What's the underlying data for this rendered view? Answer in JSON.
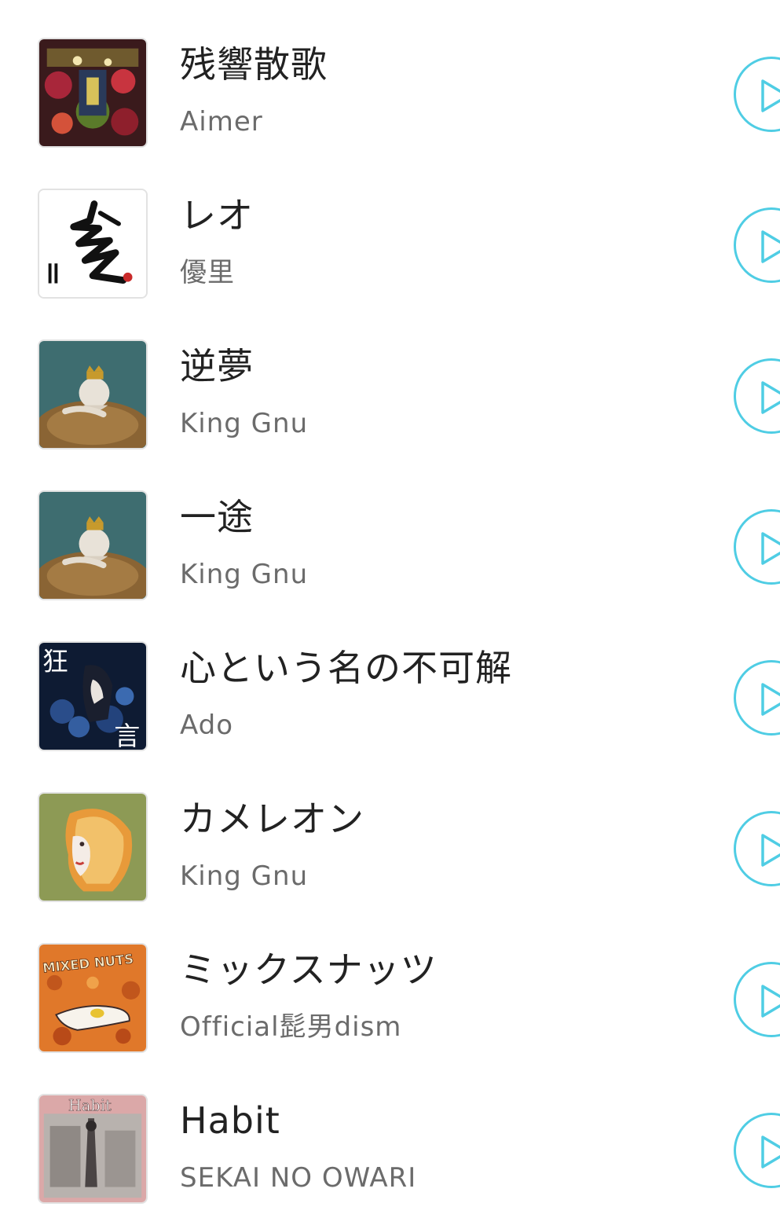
{
  "songs": [
    {
      "title": "残響散歌",
      "artist": "Aimer",
      "cover": "zankyosanka-cover"
    },
    {
      "title": "レオ",
      "artist": "優里",
      "cover": "leo-cover"
    },
    {
      "title": "逆夢",
      "artist": "King Gnu",
      "cover": "sakayume-cover"
    },
    {
      "title": "一途",
      "artist": "King Gnu",
      "cover": "ichizu-cover"
    },
    {
      "title": "心という名の不可解",
      "artist": "Ado",
      "cover": "kyougen-cover",
      "cover_text": [
        "狂",
        "言"
      ]
    },
    {
      "title": "カメレオン",
      "artist": "King Gnu",
      "cover": "chameleon-cover"
    },
    {
      "title": "ミックスナッツ",
      "artist": "Official髭男dism",
      "cover": "mixed-nuts-cover",
      "cover_text": [
        "MIXED NUTS"
      ]
    },
    {
      "title": "Habit",
      "artist": "SEKAI NO OWARI",
      "cover": "habit-cover",
      "cover_text": [
        "Habit"
      ]
    }
  ],
  "colors": {
    "play_accent": "#4fcde4",
    "title_text": "#222222",
    "artist_text": "#6b6b6b"
  },
  "icons": {
    "play": "play-outline-icon"
  }
}
